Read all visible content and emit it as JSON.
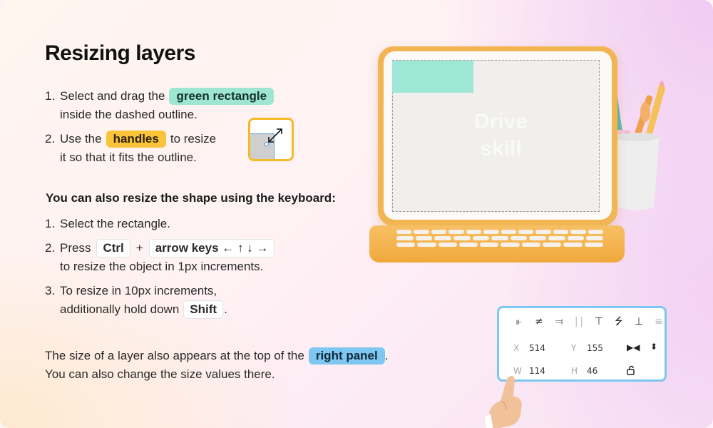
{
  "title": "Resizing layers",
  "steps_drag": [
    {
      "num": "1.",
      "pre": "Select and drag the",
      "pill": "green rectangle",
      "line2": "inside the dashed outline."
    },
    {
      "num": "2.",
      "pre": "Use the",
      "pill": "handles",
      "post": "to resize",
      "line2": "it so that it fits the outline."
    }
  ],
  "keyboard_heading": "You can also resize the shape using the keyboard:",
  "steps_keyboard": [
    {
      "num": "1.",
      "text": "Select the rectangle."
    },
    {
      "num": "2.",
      "pre": "Press",
      "key1": "Ctrl",
      "plus": "+",
      "key2": "arrow keys ← ↑ ↓ →",
      "line2": "to resize the object in 1px increments."
    },
    {
      "num": "3.",
      "text": "To resize in 10px increments,",
      "line2_pre": "additionally hold down",
      "key": "Shift",
      "line2_post": "."
    }
  ],
  "footer": {
    "line1_pre": "The size of a layer also appears at the top of the",
    "pill": "right panel",
    "line1_post": ".",
    "line2": "You can also change the size values there."
  },
  "illustration": {
    "ghost_text_1": "Drive",
    "ghost_text_2": "skill"
  },
  "right_panel": {
    "align_icons": [
      "align-left-icon",
      "align-center-horizontal-icon",
      "align-right-icon",
      "distribute-horizontal-icon",
      "align-top-icon",
      "align-center-vertical-icon",
      "align-bottom-icon",
      "distribute-vertical-icon"
    ],
    "x_label": "X",
    "x_value": "514",
    "y_label": "Y",
    "y_value": "155",
    "w_label": "W",
    "w_value": "114",
    "h_label": "H",
    "h_value": "46"
  },
  "colors": {
    "green_pill": "#9ee6d2",
    "yellow_pill": "#f9c43a",
    "blue_pill": "#7ec7f0",
    "laptop_orange": "#f2b554"
  }
}
